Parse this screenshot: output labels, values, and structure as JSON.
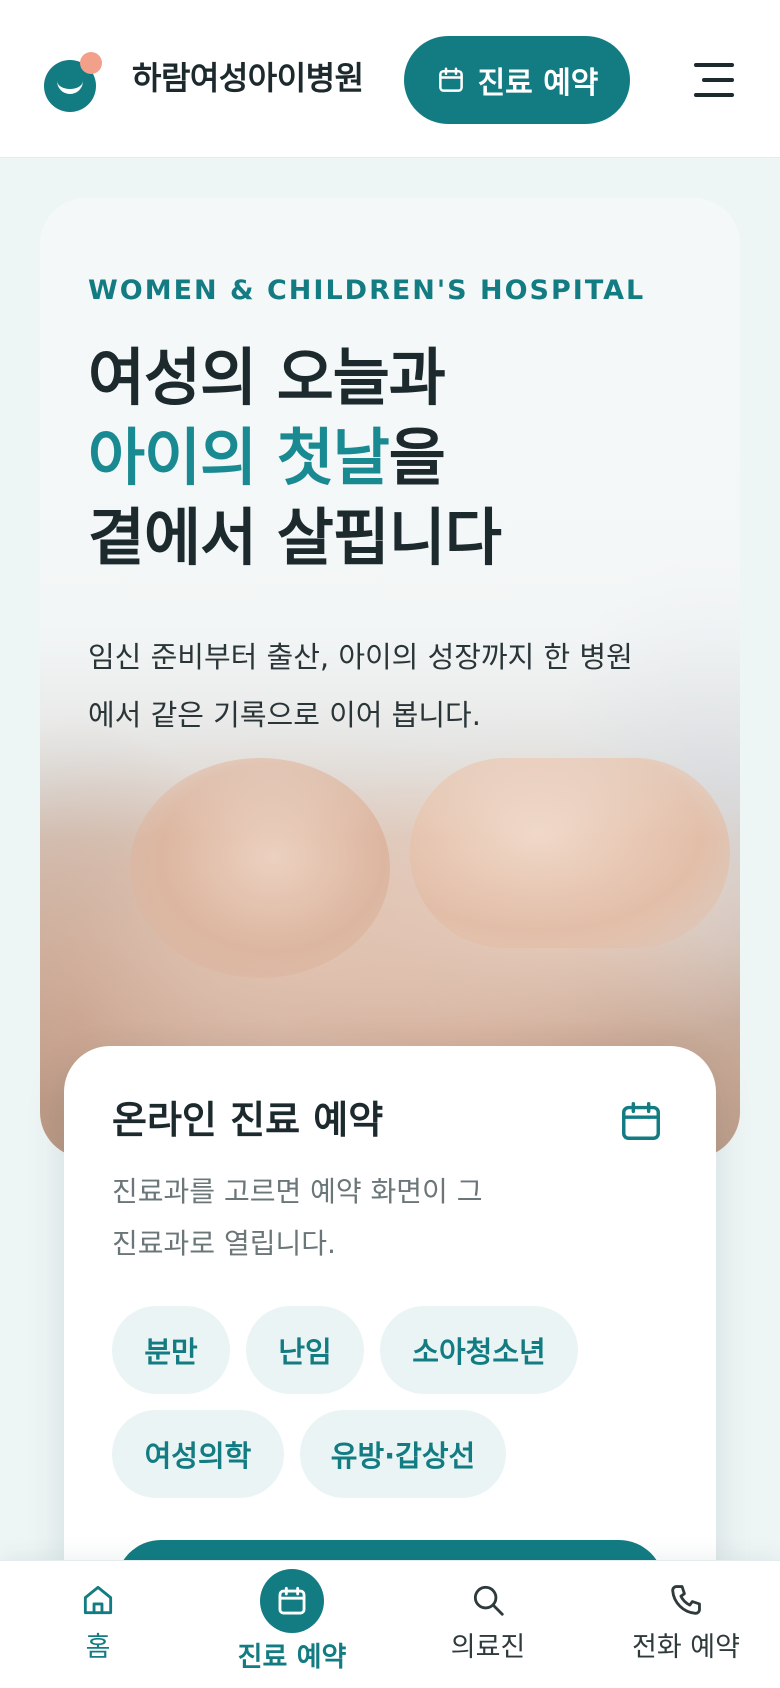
{
  "header": {
    "brand": "하람여성아이병원",
    "reserve_label": "진료 예약"
  },
  "hero": {
    "eyebrow": "WOMEN & CHILDREN'S HOSPITAL",
    "headline_line1": "여성의 오늘과",
    "headline_line2_accent": "아이의 첫날",
    "headline_line2_rest": "을",
    "headline_line3": "곁에서 살핍니다",
    "description": "임신 준비부터 출산, 아이의 성장까지 한 병원에서 같은 기록으로 이어 봅니다."
  },
  "booking": {
    "title": "온라인 진료 예약",
    "description": "진료과를 고르면 예약 화면이 그 진료과로 열립니다.",
    "departments": [
      "분만",
      "난임",
      "소아청소년",
      "여성의학",
      "유방·갑상선"
    ]
  },
  "bottom_nav": {
    "items": [
      {
        "label": "홈",
        "icon": "home-icon"
      },
      {
        "label": "진료 예약",
        "icon": "calendar-icon"
      },
      {
        "label": "의료진",
        "icon": "search-icon"
      },
      {
        "label": "전화 예약",
        "icon": "phone-icon"
      }
    ],
    "active_index": 1
  },
  "colors": {
    "primary": "#137c83",
    "accent_dot": "#f2a08a",
    "chip_bg": "#eaf4f4"
  }
}
